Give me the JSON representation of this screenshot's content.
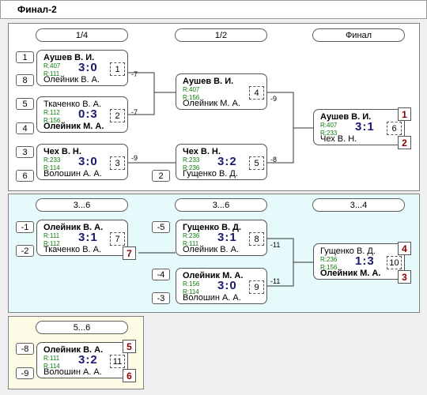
{
  "title": "Финал-2",
  "sections": {
    "main": {
      "rounds": [
        "1/4",
        "1/2",
        "Финал"
      ]
    },
    "consolation_3_6": {
      "rounds": [
        "3...6",
        "3...6",
        "3...4"
      ]
    },
    "consolation_5_6": {
      "rounds": [
        "5...6"
      ]
    }
  },
  "matches": [
    {
      "id": 1,
      "p1": "Аушев В. И.",
      "p1_bold": true,
      "r1": "R:407",
      "p2": "Олейник В. А.",
      "p2_bold": false,
      "r2": "R:111",
      "score": "3:0"
    },
    {
      "id": 2,
      "p1": "Ткаченко В. А.",
      "p1_bold": false,
      "r1": "R:112",
      "p2": "Олейник М. А.",
      "p2_bold": true,
      "r2": "R:156",
      "score": "0:3"
    },
    {
      "id": 3,
      "p1": "Чех В. Н.",
      "p1_bold": true,
      "r1": "R:233",
      "p2": "Волошин А. А.",
      "p2_bold": false,
      "r2": "R:114",
      "score": "3:0"
    },
    {
      "id": 4,
      "p1": "Аушев В. И.",
      "p1_bold": true,
      "r1": "R:407",
      "p2": "Олейник М. А.",
      "p2_bold": false,
      "r2": "R:156",
      "score": ""
    },
    {
      "id": 5,
      "p1": "Чех В. Н.",
      "p1_bold": true,
      "r1": "R:233",
      "p2": "Гущенко В. Д.",
      "p2_bold": false,
      "r2": "R:236",
      "score": "3:2"
    },
    {
      "id": 6,
      "p1": "Аушев В. И.",
      "p1_bold": true,
      "r1": "R:407",
      "p2": "Чех В. Н.",
      "p2_bold": false,
      "r2": "R:233",
      "score": "3:1"
    },
    {
      "id": 7,
      "p1": "Олейник В. А.",
      "p1_bold": true,
      "r1": "R:111",
      "p2": "Ткаченко В. А.",
      "p2_bold": false,
      "r2": "R:112",
      "score": "3:1"
    },
    {
      "id": 8,
      "p1": "Гущенко В. Д.",
      "p1_bold": true,
      "r1": "R:236",
      "p2": "Олейник В. А.",
      "p2_bold": false,
      "r2": "R:111",
      "score": "3:1"
    },
    {
      "id": 9,
      "p1": "Олейник М. А.",
      "p1_bold": true,
      "r1": "R:156",
      "p2": "Волошин А. А.",
      "p2_bold": false,
      "r2": "R:114",
      "score": "3:0"
    },
    {
      "id": 10,
      "p1": "Гущенко В. Д.",
      "p1_bold": false,
      "r1": "R:236",
      "p2": "Олейник М. А.",
      "p2_bold": true,
      "r2": "R:156",
      "score": "1:3"
    },
    {
      "id": 11,
      "p1": "Олейник В. А.",
      "p1_bold": true,
      "r1": "R:111",
      "p2": "Волошин А. А.",
      "p2_bold": false,
      "r2": "R:114",
      "score": "3:2"
    }
  ],
  "seeds": [
    "1",
    "8",
    "5",
    "4",
    "3",
    "6",
    "2",
    "-1",
    "-2",
    "-5",
    "-4",
    "-3",
    "-8",
    "-9"
  ],
  "loser_refs": [
    "-7",
    "-7",
    "-9",
    "-9",
    "-8",
    "-11",
    "-11"
  ],
  "places": [
    "1",
    "2",
    "7",
    "4",
    "3",
    "5",
    "6"
  ],
  "colors": {
    "place_text": "#8b0000",
    "score_text": "#1a1a70",
    "rating_text": "#0a7a0a",
    "panel_cyan": "#e6fafb",
    "panel_yellow": "#fdfbe6"
  }
}
